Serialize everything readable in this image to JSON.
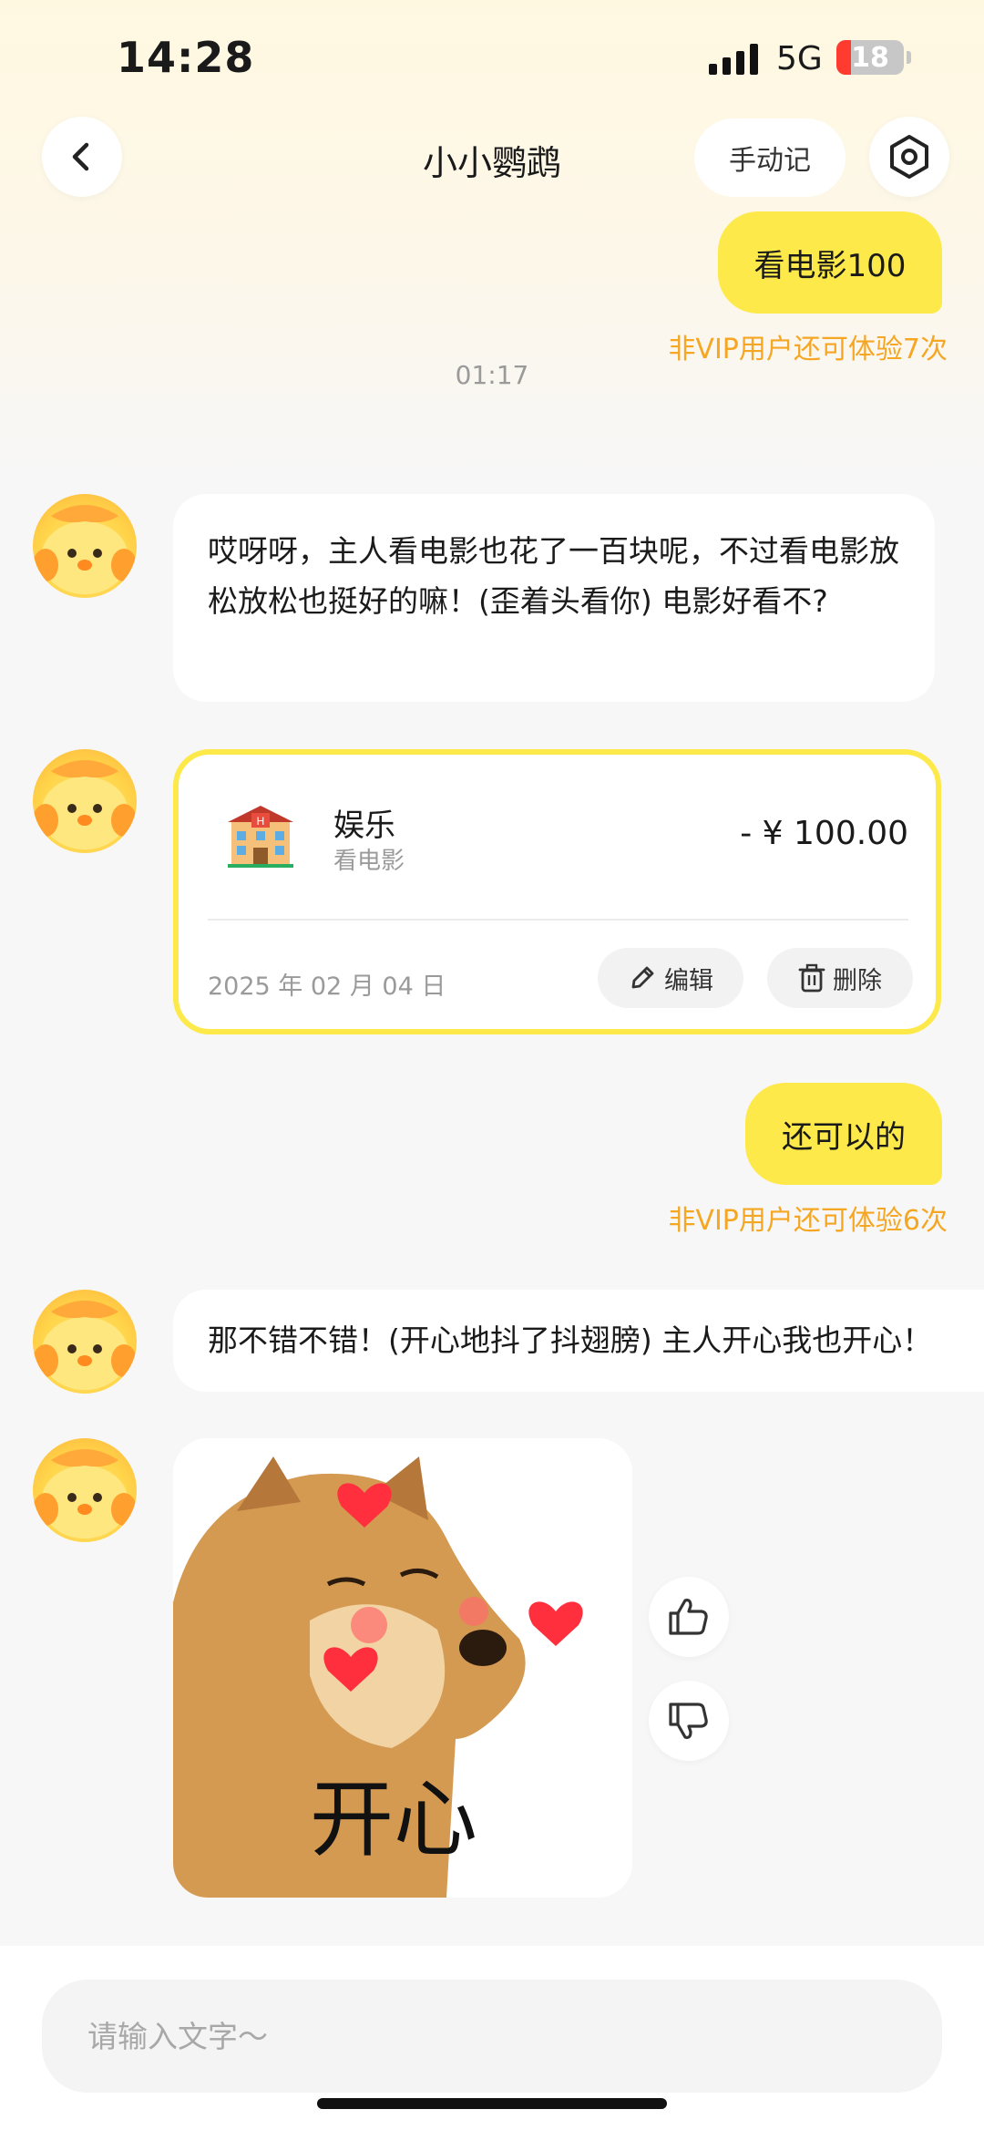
{
  "status_bar": {
    "time": "14:28",
    "network": "5G",
    "battery": "18"
  },
  "nav": {
    "title": "小小鹦鹉",
    "manual_button": "手动记"
  },
  "messages": {
    "user_1": {
      "text": "看电影100",
      "vip_note": "非VIP用户还可体验7次"
    },
    "timestamp": "01:17",
    "bot_1": {
      "text": "哎呀呀，主人看电影也花了一百块呢，不过看电影放松放松也挺好的嘛！(歪着头看你) 电影好看不?"
    },
    "record_card": {
      "category": "娱乐",
      "subcategory": "看电影",
      "amount": "- ¥ 100.00",
      "date": "2025 年 02 月 04 日",
      "edit_label": "编辑",
      "delete_label": "删除",
      "icon": "hotel-icon"
    },
    "user_2": {
      "text": "还可以的",
      "vip_note": "非VIP用户还可体验6次"
    },
    "bot_2": {
      "text": "那不错不错！(开心地抖了抖翅膀) 主人开心我也开心！"
    },
    "sticker": {
      "caption": "开心"
    }
  },
  "input": {
    "placeholder": "请输入文字～"
  },
  "colors": {
    "accent_yellow": "#fde94a",
    "vip_orange": "#f5a623",
    "muted_gray": "#9a9a9a"
  }
}
